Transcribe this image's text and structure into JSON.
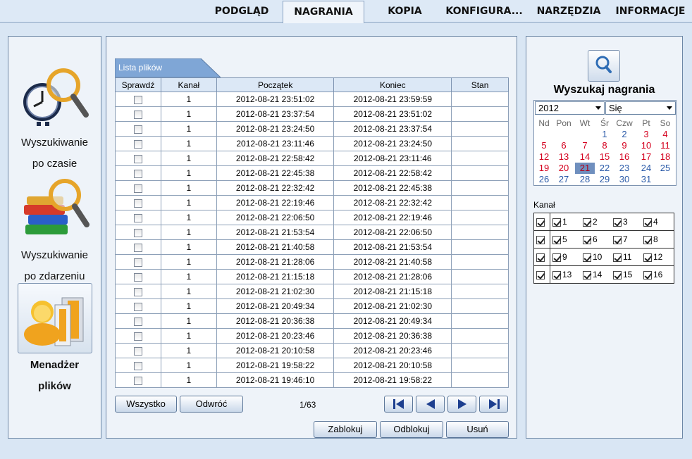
{
  "tabs": [
    {
      "label": "PODGLĄD",
      "active": false
    },
    {
      "label": "NAGRANIA",
      "active": true
    },
    {
      "label": "KOPIA",
      "active": false
    },
    {
      "label": "KONFIGURA...",
      "active": false
    },
    {
      "label": "NARZĘDZIA",
      "active": false
    },
    {
      "label": "INFORMACJE",
      "active": false
    }
  ],
  "sidebar": {
    "time_search": {
      "line1": "Wyszukiwanie",
      "line2": "po czasie"
    },
    "event_search": {
      "line1": "Wyszukiwanie",
      "line2": "po zdarzeniu"
    },
    "file_manager": {
      "line1": "Menadżer",
      "line2": "plików"
    }
  },
  "file_list": {
    "tab_label": "Lista plików",
    "columns": [
      "Sprawdź",
      "Kanał",
      "Początek",
      "Koniec",
      "Stan"
    ],
    "rows": [
      {
        "channel": "1",
        "start": "2012-08-21 23:51:02",
        "end": "2012-08-21 23:59:59",
        "state": ""
      },
      {
        "channel": "1",
        "start": "2012-08-21 23:37:54",
        "end": "2012-08-21 23:51:02",
        "state": ""
      },
      {
        "channel": "1",
        "start": "2012-08-21 23:24:50",
        "end": "2012-08-21 23:37:54",
        "state": ""
      },
      {
        "channel": "1",
        "start": "2012-08-21 23:11:46",
        "end": "2012-08-21 23:24:50",
        "state": ""
      },
      {
        "channel": "1",
        "start": "2012-08-21 22:58:42",
        "end": "2012-08-21 23:11:46",
        "state": ""
      },
      {
        "channel": "1",
        "start": "2012-08-21 22:45:38",
        "end": "2012-08-21 22:58:42",
        "state": ""
      },
      {
        "channel": "1",
        "start": "2012-08-21 22:32:42",
        "end": "2012-08-21 22:45:38",
        "state": ""
      },
      {
        "channel": "1",
        "start": "2012-08-21 22:19:46",
        "end": "2012-08-21 22:32:42",
        "state": ""
      },
      {
        "channel": "1",
        "start": "2012-08-21 22:06:50",
        "end": "2012-08-21 22:19:46",
        "state": ""
      },
      {
        "channel": "1",
        "start": "2012-08-21 21:53:54",
        "end": "2012-08-21 22:06:50",
        "state": ""
      },
      {
        "channel": "1",
        "start": "2012-08-21 21:40:58",
        "end": "2012-08-21 21:53:54",
        "state": ""
      },
      {
        "channel": "1",
        "start": "2012-08-21 21:28:06",
        "end": "2012-08-21 21:40:58",
        "state": ""
      },
      {
        "channel": "1",
        "start": "2012-08-21 21:15:18",
        "end": "2012-08-21 21:28:06",
        "state": ""
      },
      {
        "channel": "1",
        "start": "2012-08-21 21:02:30",
        "end": "2012-08-21 21:15:18",
        "state": ""
      },
      {
        "channel": "1",
        "start": "2012-08-21 20:49:34",
        "end": "2012-08-21 21:02:30",
        "state": ""
      },
      {
        "channel": "1",
        "start": "2012-08-21 20:36:38",
        "end": "2012-08-21 20:49:34",
        "state": ""
      },
      {
        "channel": "1",
        "start": "2012-08-21 20:23:46",
        "end": "2012-08-21 20:36:38",
        "state": ""
      },
      {
        "channel": "1",
        "start": "2012-08-21 20:10:58",
        "end": "2012-08-21 20:23:46",
        "state": ""
      },
      {
        "channel": "1",
        "start": "2012-08-21 19:58:22",
        "end": "2012-08-21 20:10:58",
        "state": ""
      },
      {
        "channel": "1",
        "start": "2012-08-21 19:46:10",
        "end": "2012-08-21 19:58:22",
        "state": ""
      }
    ]
  },
  "buttons": {
    "select_all": "Wszystko",
    "invert": "Odwróć",
    "lock": "Zablokuj",
    "unlock": "Odblokuj",
    "delete": "Usuń"
  },
  "pagination": {
    "label": "1/63",
    "icons": [
      "first-page-icon",
      "prev-page-icon",
      "next-page-icon",
      "last-page-icon"
    ]
  },
  "search": {
    "title": "Wyszukaj nagrania",
    "year": "2012",
    "month": "Się",
    "weekdays": [
      "Nd",
      "Pon",
      "Wt",
      "Śr",
      "Czw",
      "Pt",
      "So"
    ],
    "weeks": [
      [
        "",
        "",
        "",
        "1",
        "2",
        "3",
        "4"
      ],
      [
        "5",
        "6",
        "7",
        "8",
        "9",
        "10",
        "11"
      ],
      [
        "12",
        "13",
        "14",
        "15",
        "16",
        "17",
        "18"
      ],
      [
        "19",
        "20",
        "21",
        "22",
        "23",
        "24",
        "25"
      ],
      [
        "26",
        "27",
        "28",
        "29",
        "30",
        "31",
        ""
      ]
    ],
    "days_with_recordings": [
      "3",
      "4",
      "5",
      "6",
      "7",
      "8",
      "9",
      "10",
      "11",
      "12",
      "13",
      "14",
      "15",
      "16",
      "17",
      "18",
      "19",
      "20",
      "21"
    ],
    "selected_day": "21",
    "channel_label": "Kanał",
    "channels": [
      [
        "1",
        "2",
        "3",
        "4"
      ],
      [
        "5",
        "6",
        "7",
        "8"
      ],
      [
        "9",
        "10",
        "11",
        "12"
      ],
      [
        "13",
        "14",
        "15",
        "16"
      ]
    ],
    "all_channels_checked": true
  },
  "colors": {
    "accent": "#6f8fbe",
    "red_day": "#d4001e",
    "blue_day": "#2a5aa8",
    "tab_header": "#7fa6d6"
  }
}
